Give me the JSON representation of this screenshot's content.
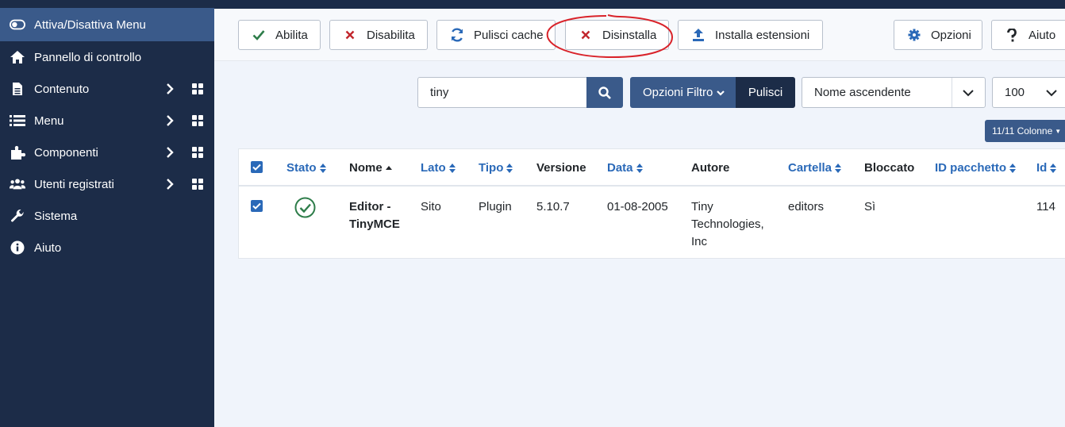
{
  "sidebar": {
    "items": [
      {
        "label": "Attiva/Disattiva Menu",
        "icon": "toggle-icon"
      },
      {
        "label": "Pannello di controllo",
        "icon": "home-icon"
      },
      {
        "label": "Contenuto",
        "icon": "file-icon"
      },
      {
        "label": "Menu",
        "icon": "list-icon"
      },
      {
        "label": "Componenti",
        "icon": "puzzle-icon"
      },
      {
        "label": "Utenti registrati",
        "icon": "users-icon"
      },
      {
        "label": "Sistema",
        "icon": "wrench-icon"
      },
      {
        "label": "Aiuto",
        "icon": "info-icon"
      }
    ]
  },
  "toolbar": {
    "enable": "Abilita",
    "disable": "Disabilita",
    "clear_cache": "Pulisci cache",
    "uninstall": "Disinstalla",
    "install": "Installa estensioni",
    "options": "Opzioni",
    "help": "Aiuto"
  },
  "search": {
    "value": "tiny",
    "filter_options": "Opzioni Filtro",
    "clear": "Pulisci",
    "sort": "Nome ascendente",
    "limit": "100",
    "columns": "11/11 Colonne"
  },
  "table": {
    "headers": {
      "status": "Stato",
      "name": "Nome",
      "side": "Lato",
      "type": "Tipo",
      "version": "Versione",
      "date": "Data",
      "author": "Autore",
      "folder": "Cartella",
      "locked": "Bloccato",
      "package_id": "ID pacchetto",
      "id": "Id"
    },
    "rows": [
      {
        "name_line1": "Editor -",
        "name_line2": "TinyMCE",
        "side": "Sito",
        "type": "Plugin",
        "version": "5.10.7",
        "date": "01-08-2005",
        "author_line1": "Tiny",
        "author_line2": "Technologies,",
        "author_line3": "Inc",
        "folder": "editors",
        "locked": "Sì",
        "package_id": "",
        "id": "114"
      }
    ]
  },
  "colors": {
    "sidebar": "#1c2c48",
    "active": "#3a5a8a",
    "link": "#2a69b8",
    "success": "#2e7d4a",
    "danger": "#c2272d"
  }
}
